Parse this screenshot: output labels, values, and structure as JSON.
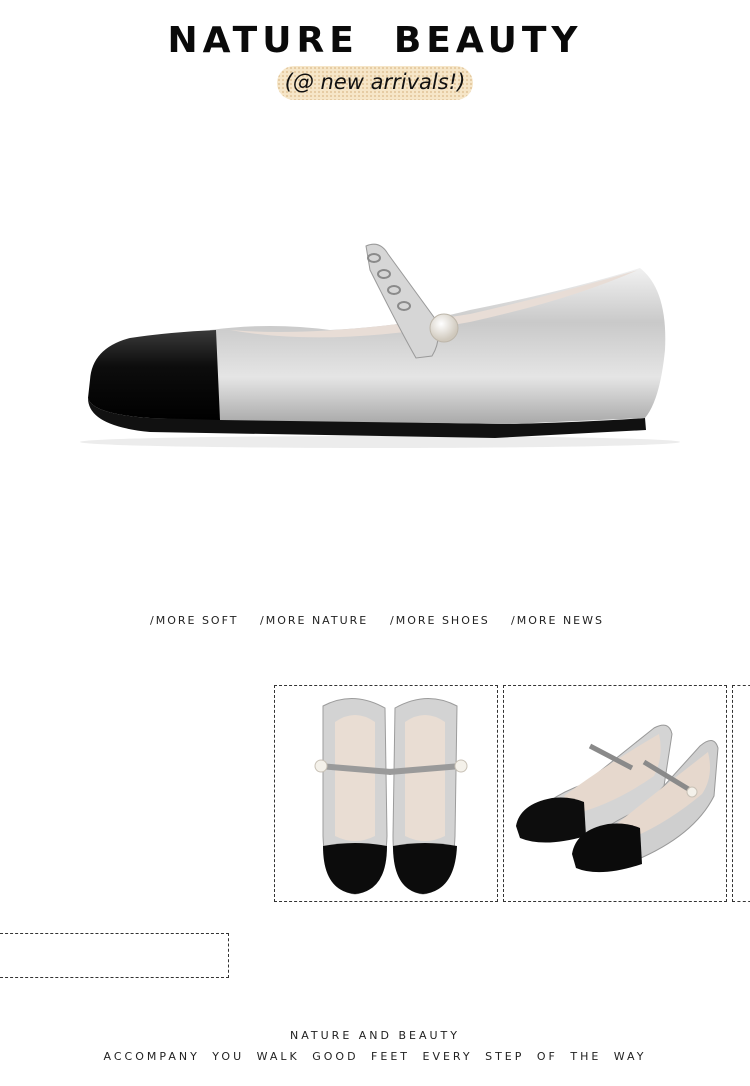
{
  "header": {
    "title": "NATURE  BEAUTY",
    "badge": "(@ new arrivals!)"
  },
  "hero_image": {
    "alt": "silver mary jane flat with black cap toe and chain strap",
    "icon": "shoe-side-view"
  },
  "nav": {
    "items": [
      "/MORE SOFT",
      "/MORE NATURE",
      "/MORE SHOES",
      "/MORE NEWS"
    ]
  },
  "gallery": {
    "items": [
      {
        "alt": "pair of shoes top view",
        "icon": "shoes-top-view"
      },
      {
        "alt": "pair of shoes angled view",
        "icon": "shoes-angled-view"
      },
      {
        "alt": "partially visible frame",
        "icon": "image-frame"
      }
    ]
  },
  "footer": {
    "line1": "NATURE AND BEAUTY",
    "line2": "ACCOMPANY YOU WALK GOOD FEET EVERY STEP OF THE WAY"
  },
  "colors": {
    "badge_bg": "#f6e6c8",
    "silver": "#cfcfcf",
    "patent_black": "#111111"
  }
}
